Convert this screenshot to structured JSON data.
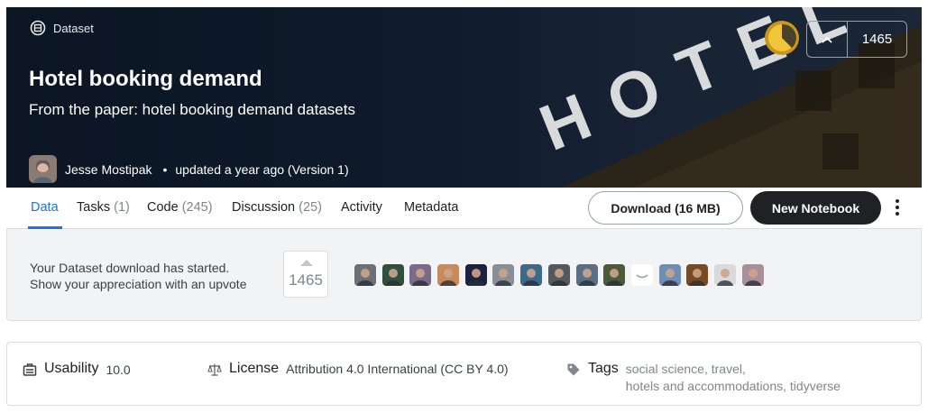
{
  "header": {
    "type_label": "Dataset",
    "title": "Hotel booking demand",
    "subtitle": "From the paper: hotel booking demand datasets",
    "author": "Jesse Mostipak",
    "updated": "updated a year ago (Version 1)",
    "banner_sign": "HOTEL",
    "upvotes": "1465",
    "medal_color": "#e5b52a"
  },
  "tabs": [
    {
      "label": "Data",
      "count": ""
    },
    {
      "label": "Tasks",
      "count": "(1)"
    },
    {
      "label": "Code",
      "count": "(245)"
    },
    {
      "label": "Discussion",
      "count": "(25)"
    },
    {
      "label": "Activity",
      "count": ""
    },
    {
      "label": "Metadata",
      "count": ""
    }
  ],
  "actions": {
    "download": "Download (16 MB)",
    "new_notebook": "New Notebook"
  },
  "notice": {
    "line1": "Your Dataset download has started.",
    "line2": "Show your appreciation with an upvote",
    "upvotes": "1465",
    "voter_count": 15
  },
  "meta": {
    "usability_label": "Usability",
    "usability_value": "10.0",
    "license_label": "License",
    "license_value": "Attribution 4.0 International (CC BY 4.0)",
    "tags_label": "Tags",
    "tags": [
      "social science",
      "travel",
      "hotels and accommodations",
      "tidyverse"
    ]
  },
  "colors": {
    "accent": "#1a73e8",
    "banner_bg": "#0f1b2b"
  }
}
